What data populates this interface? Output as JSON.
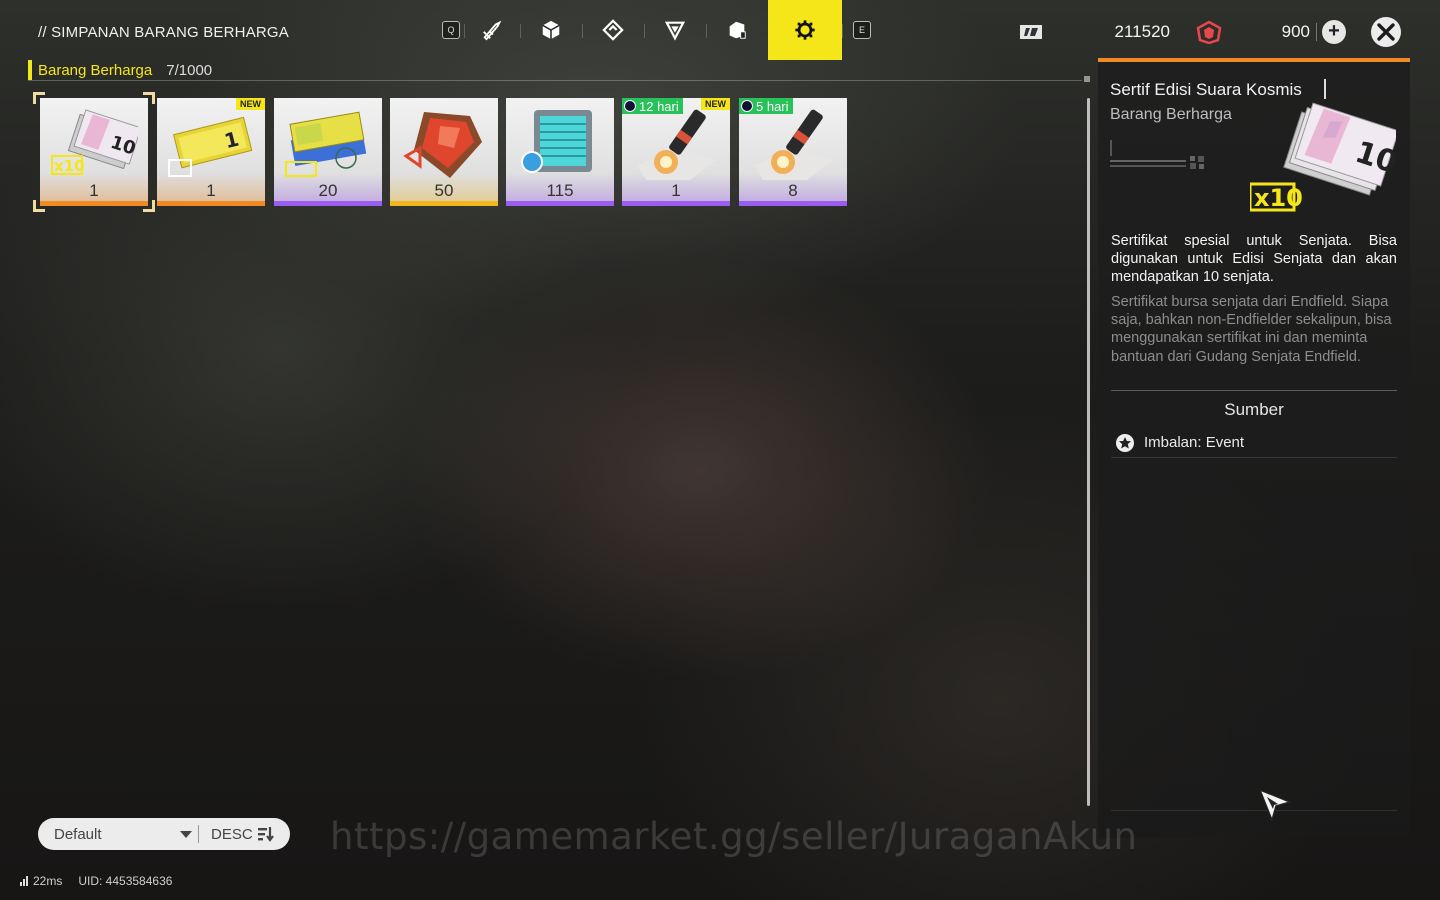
{
  "header": {
    "title": "// SIMPANAN BARANG BERHARGA",
    "title_bg_text": "",
    "tabs": [
      {
        "name": "q-key",
        "label": "Q"
      },
      {
        "name": "weapon-tab-icon"
      },
      {
        "name": "cube-tab-icon"
      },
      {
        "name": "diamond-tab-icon"
      },
      {
        "name": "triangle-tab-icon"
      },
      {
        "name": "box-tab-icon"
      },
      {
        "name": "gear-tab-icon",
        "active": true
      },
      {
        "name": "e-key",
        "label": "E"
      }
    ],
    "q_key": "Q",
    "e_key": "E",
    "currency_1": {
      "icon": "ticket-icon",
      "value": "211520"
    },
    "currency_2": {
      "icon": "origeometry-icon",
      "value": "900"
    },
    "plus_label": "+"
  },
  "category": {
    "label": "Barang Berharga",
    "count": "7/1000"
  },
  "items": [
    {
      "qty": "1",
      "rarity": "orange",
      "icon": "weapon-ticket-x10-icon",
      "selected": true
    },
    {
      "qty": "1",
      "rarity": "orange",
      "icon": "yellow-ticket-icon",
      "badge_new": "NEW"
    },
    {
      "qty": "20",
      "rarity": "purple",
      "icon": "exchange-ticket-icon"
    },
    {
      "qty": "50",
      "rarity": "gold",
      "icon": "red-crystal-icon"
    },
    {
      "qty": "115",
      "rarity": "purple",
      "icon": "teal-module-icon"
    },
    {
      "qty": "1",
      "rarity": "purple",
      "icon": "firework-icon",
      "badge_time": "12 hari",
      "badge_new": "NEW"
    },
    {
      "qty": "8",
      "rarity": "purple",
      "icon": "firework-icon",
      "badge_time": "5 hari"
    }
  ],
  "detail": {
    "name": "Sertif Edisi Suara Kosmis",
    "type": "Barang Berharga",
    "description": "Sertifikat spesial untuk Senjata. Bisa digunakan untuk Edisi Senjata dan akan mendapatkan 10 senjata.",
    "lore": "Sertifikat bursa senjata dari Endfield. Siapa saja, bahkan non-Endfielder sekalipun, bisa menggunakan sertifikat ini dan meminta bantuan dari Gudang Senjata Endfield.",
    "source_title": "Sumber",
    "sources": [
      {
        "icon": "event-star-icon",
        "label": "Imbalan: Event"
      }
    ]
  },
  "sort": {
    "selected": "Default",
    "order": "DESC"
  },
  "watermark": "https://gamemarket.gg/seller/JuraganAkun",
  "footer": {
    "ping": "22ms",
    "uid": "UID: 4453584636"
  },
  "colors": {
    "accent": "#f5e61a",
    "rarity_orange": "#f08a23",
    "rarity_gold": "#f2b51c",
    "rarity_purple": "#9b5cf0",
    "timer_green": "#29c15a"
  }
}
